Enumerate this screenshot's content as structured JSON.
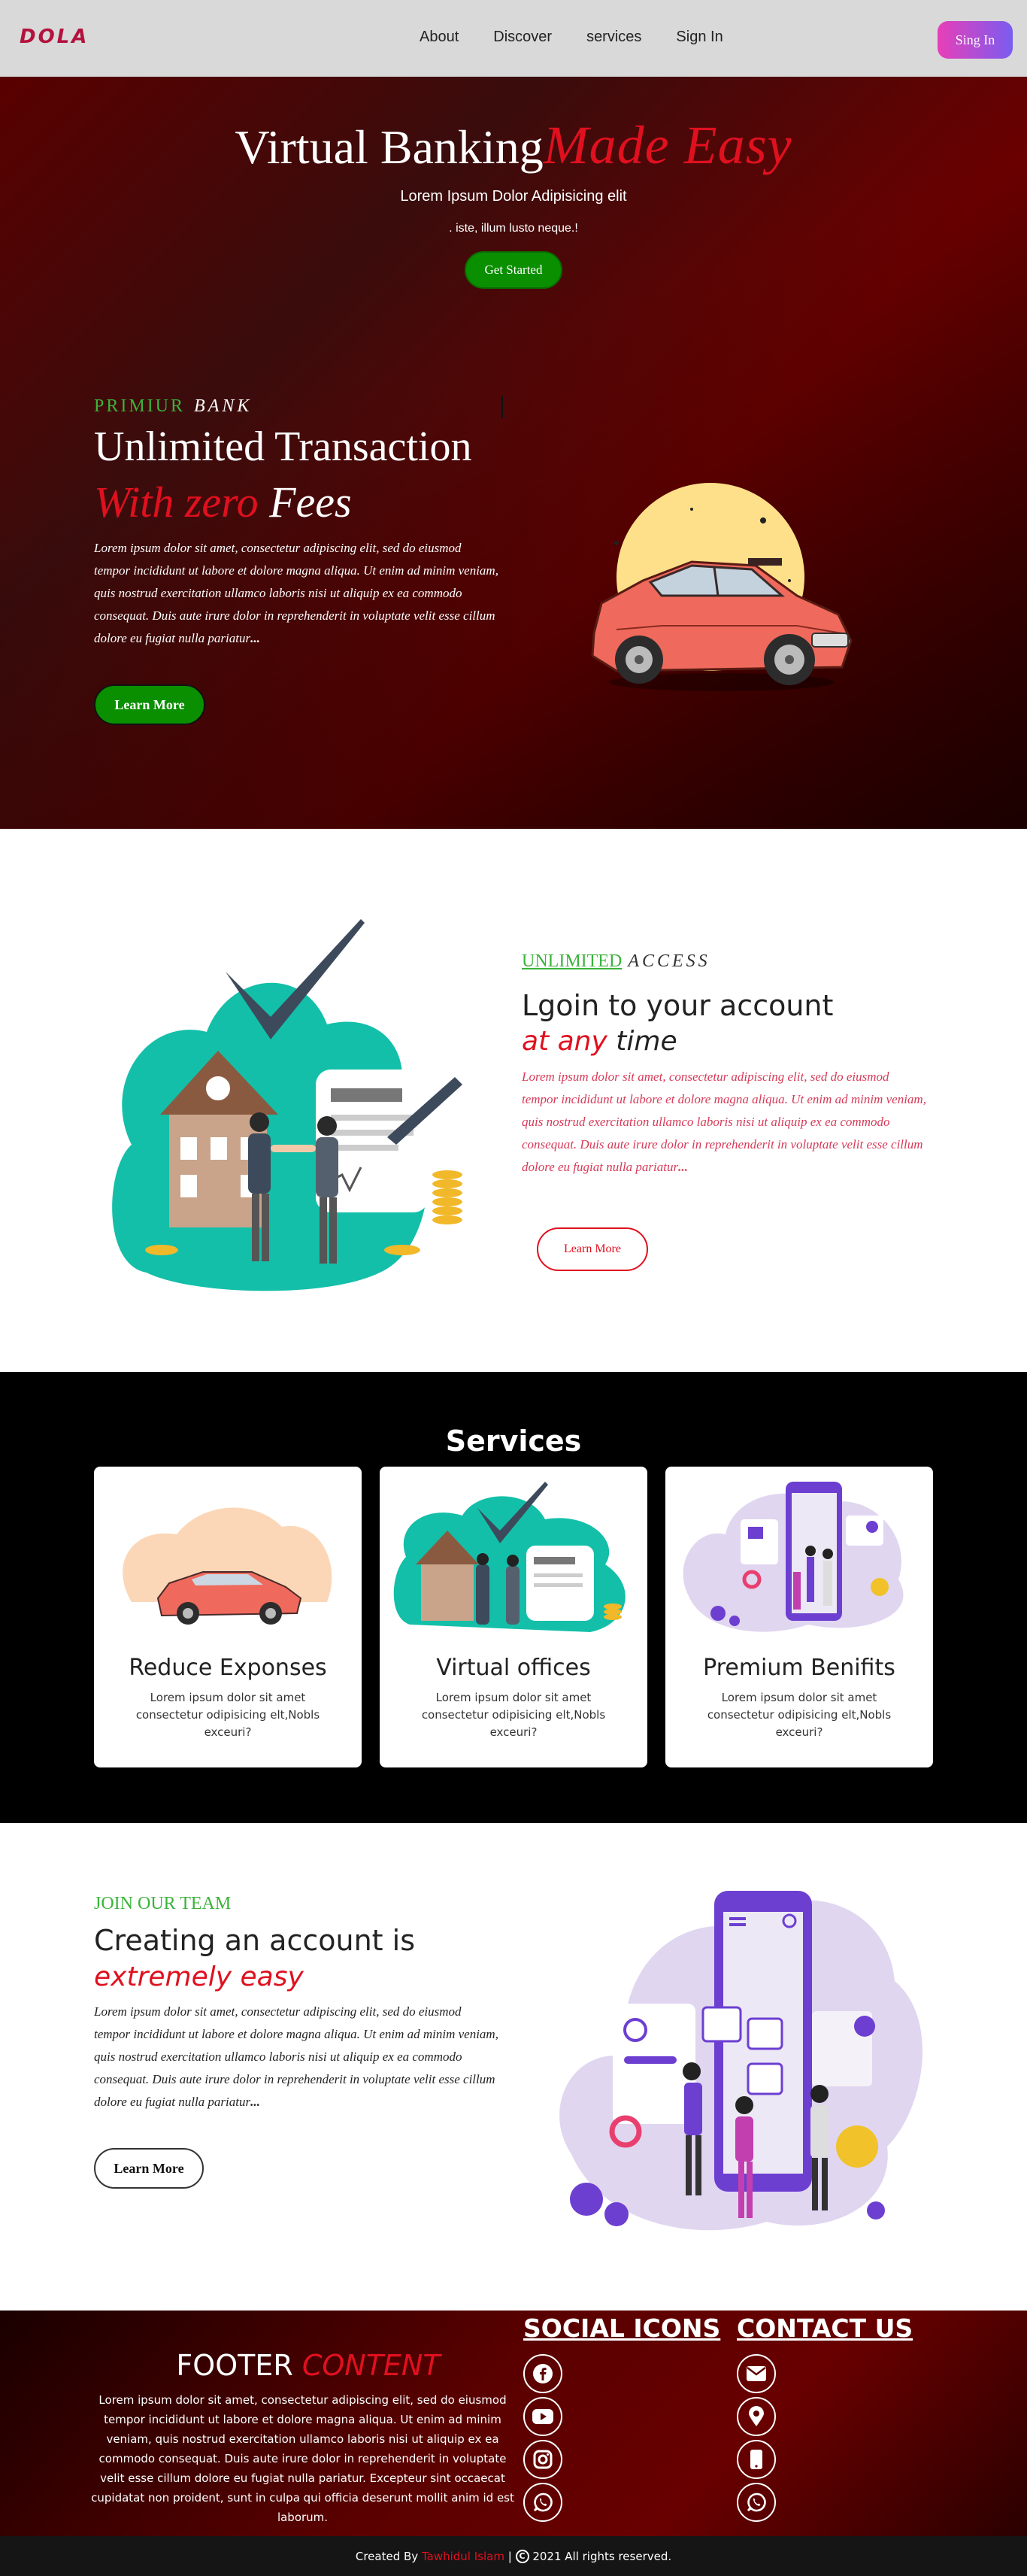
{
  "nav": {
    "logo": "DOLA",
    "links": [
      "About",
      "Discover",
      "services",
      "Sign In"
    ],
    "button": "Sing In"
  },
  "hero": {
    "title_a": "Virtual Banking",
    "title_b": "Made Easy",
    "subtitle": "Lorem Ipsum Dolor Adipisicing elit",
    "subtitle2": ". iste, illum lusto neque.!",
    "button": "Get Started",
    "tag_a": "PRIMIUR",
    "tag_b": "BANK",
    "heading": "Unlimited Transaction",
    "heading2_a": "With zero",
    "heading2_b": "Fees",
    "paragraph": "Lorem ipsum dolor sit amet, consectetur adipiscing elit, sed do eiusmod tempor incididunt ut labore et dolore magna aliqua. Ut enim ad minim veniam, quis nostrud exercitation ullamco laboris nisi ut aliquip ex ea commodo consequat. Duis aute irure dolor in reprehenderit in voluptate velit esse cillum dolore eu fugiat nulla pariatur",
    "ellipsis": "...",
    "learn": "Learn More"
  },
  "login": {
    "tag_a": "UNLIMITED",
    "tag_b": "ACCESS",
    "heading": "Lgoin to your account",
    "heading2_a": "at any",
    "heading2_b": "time",
    "paragraph": "Lorem ipsum dolor sit amet, consectetur adipiscing elit, sed do eiusmod tempor incididunt ut labore et dolore magna aliqua. Ut enim ad minim veniam, quis nostrud exercitation ullamco laboris nisi ut aliquip ex ea commodo consequat. Duis aute irure dolor in reprehenderit in voluptate velit esse cillum dolore eu fugiat nulla pariatur",
    "ellipsis": "...",
    "learn": "Learn More"
  },
  "services": {
    "title": "Services",
    "cards": [
      {
        "title": "Reduce Exponses",
        "desc": "Lorem ipsum dolor sit amet consectetur odipisicing elt,Nobls exceuri?"
      },
      {
        "title": "Virtual offices",
        "desc": "Lorem ipsum dolor sit amet consectetur odipisicing elt,Nobls exceuri?"
      },
      {
        "title": "Premium Benifits",
        "desc": "Lorem ipsum dolor sit amet consectetur odipisicing elt,Nobls exceuri?"
      }
    ]
  },
  "join": {
    "tag": "JOIN OUR TEAM",
    "heading": "Creating an account is",
    "heading2": "extremely easy",
    "paragraph": "Lorem ipsum dolor sit amet, consectetur adipiscing elit, sed do eiusmod tempor incididunt ut labore et dolore magna aliqua. Ut enim ad minim veniam, quis nostrud exercitation ullamco laboris nisi ut aliquip ex ea commodo consequat. Duis aute irure dolor in reprehenderit in voluptate velit esse cillum dolore eu fugiat nulla pariatur",
    "ellipsis": "...",
    "learn": "Learn More"
  },
  "footer": {
    "title_a": "FOOTER",
    "title_b": "CONTENT",
    "paragraph": "Lorem ipsum dolor sit amet, consectetur adipiscing elit, sed do eiusmod tempor incididunt ut labore et dolore magna aliqua. Ut enim ad minim veniam, quis nostrud exercitation ullamco laboris nisi ut aliquip ex ea commodo consequat. Duis aute irure dolor in reprehenderit in voluptate velit esse cillum dolore eu fugiat nulla pariatur. Excepteur sint occaecat cupidatat non proident, sunt in culpa qui officia deserunt mollit anim id est laborum.",
    "social_heading": "SOCIAL ICONS",
    "contact_heading": "CONTACT US",
    "social_icons": [
      "facebook-icon",
      "youtube-icon",
      "instagram-icon",
      "whatsapp-icon"
    ],
    "contact_icons": [
      "envelope-icon",
      "location-pin-icon",
      "mobile-phone-icon",
      "whatsapp-icon"
    ]
  },
  "bottom": {
    "created_by": "Created By",
    "name": "Tawhidul Islam",
    "rights": "2021 All rights reserved."
  },
  "colors": {
    "accent_red": "#e0101f",
    "accent_green": "#3bb33b",
    "button_green": "#0a8f00",
    "teal": "#13bfa8",
    "purple": "#6c3fd1"
  }
}
